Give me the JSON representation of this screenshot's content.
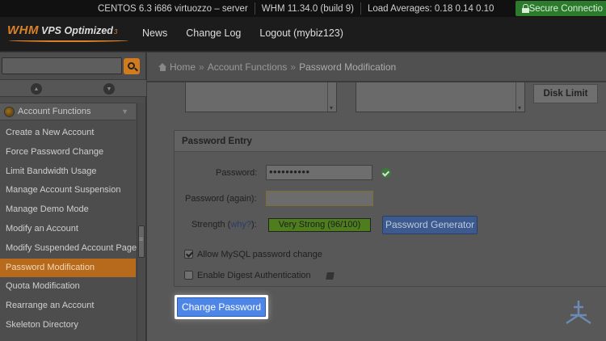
{
  "statusbar": {
    "server": "CENTOS 6.3 i686 virtuozzo – server",
    "version": "WHM 11.34.0 (build 9)",
    "load": "Load Averages: 0.18 0.14 0.10",
    "secure": "Secure Connectio"
  },
  "header": {
    "logo_whm": "WHM",
    "logo_vps": "VPS Optimized",
    "logo_num": "3",
    "nav": [
      "News",
      "Change Log",
      "Logout (mybiz123)"
    ]
  },
  "sidebar": {
    "search_placeholder": "",
    "section": "Account Functions",
    "items": [
      {
        "label": "Create a New Account"
      },
      {
        "label": "Force Password Change"
      },
      {
        "label": "Limit Bandwidth Usage"
      },
      {
        "label": "Manage Account Suspension"
      },
      {
        "label": "Manage Demo Mode"
      },
      {
        "label": "Modify an Account"
      },
      {
        "label": "Modify Suspended Account Page"
      },
      {
        "label": "Password Modification",
        "active": true
      },
      {
        "label": "Quota Modification"
      },
      {
        "label": "Rearrange an Account"
      },
      {
        "label": "Skeleton Directory"
      }
    ]
  },
  "breadcrumb": {
    "home": "Home",
    "sep": "»",
    "section": "Account Functions",
    "current": "Password Modification"
  },
  "main": {
    "disk_limit": "Disk Limit",
    "panel_title": "Password Entry",
    "password_label": "Password:",
    "password_value": "••••••••••",
    "password_again_label": "Password (again):",
    "password_again_value": "",
    "strength_label": "Strength (",
    "why_link": "why?",
    "strength_close": "):",
    "strength_value": "Very Strong (96/100)",
    "strength_color": "#4e7d1e",
    "generator_button": "Password Generator",
    "allow_mysql": "Allow MySQL password change",
    "allow_mysql_checked": true,
    "digest_auth": "Enable Digest Authentication",
    "digest_auth_checked": false,
    "change_button": "Change Password"
  },
  "colors": {
    "accent": "#d17b1e",
    "active_item": "#b86a1c",
    "button_blue": "#4e86e8",
    "secure_green": "#2c7a2c"
  }
}
